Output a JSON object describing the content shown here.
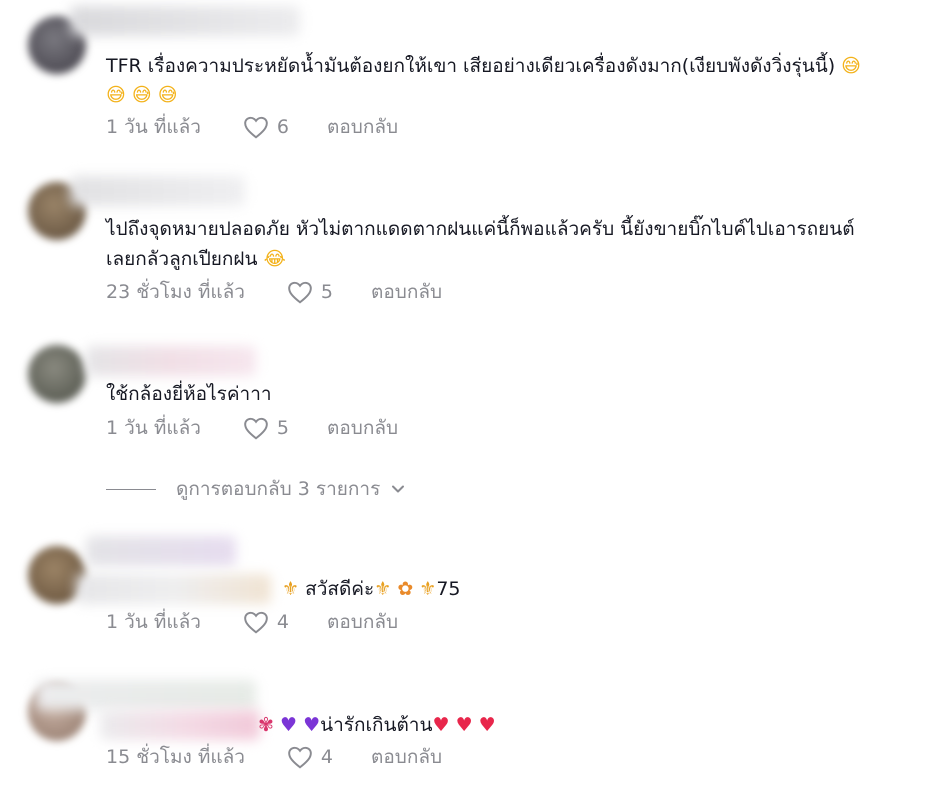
{
  "comments": [
    {
      "text_line1": "TFR เรื่องความประหยัดน้ำมันต้องยกให้เขา เสียอย่างเดียวเครื่องดังมาก(เงียบพังดังวิ่งรุ่นนี้)",
      "trailing_emoji": "😅",
      "emoji_line": "😅 😅 😅",
      "time": "1 วัน ที่แล้ว",
      "likes": "6",
      "reply": "ตอบกลับ"
    },
    {
      "text_line1": "ไปถึงจุดหมายปลอดภัย หัวไม่ตากแดดตากฝนแค่นี้ก็พอแล้วครับ นี้ยังขายบิ๊กไบค์ไปเอารถยนต์",
      "text_line2": "เลยกลัวลูกเปียกฝน",
      "trailing_emoji": "😂",
      "time": "23 ชั่วโมง ที่แล้ว",
      "likes": "5",
      "reply": "ตอบกลับ"
    },
    {
      "text_line1": "ใช้กล้องยี่ห้อไรค่าาา",
      "time": "1 วัน ที่แล้ว",
      "likes": "5",
      "reply": "ตอบกลับ"
    },
    {
      "text_line1": "สวัสดีค่ะ",
      "suffix": "75",
      "time": "1 วัน ที่แล้ว",
      "likes": "4",
      "reply": "ตอบกลับ"
    },
    {
      "text_line1": "น่ารักเกินต้าน",
      "time": "15 ชั่วโมง ที่แล้ว",
      "likes": "4",
      "reply": "ตอบกลับ"
    }
  ],
  "view_replies": "ดูการตอบกลับ 3 รายการ",
  "icons": {
    "like": "heart-outline-icon",
    "chevron": "chevron-down-icon"
  }
}
